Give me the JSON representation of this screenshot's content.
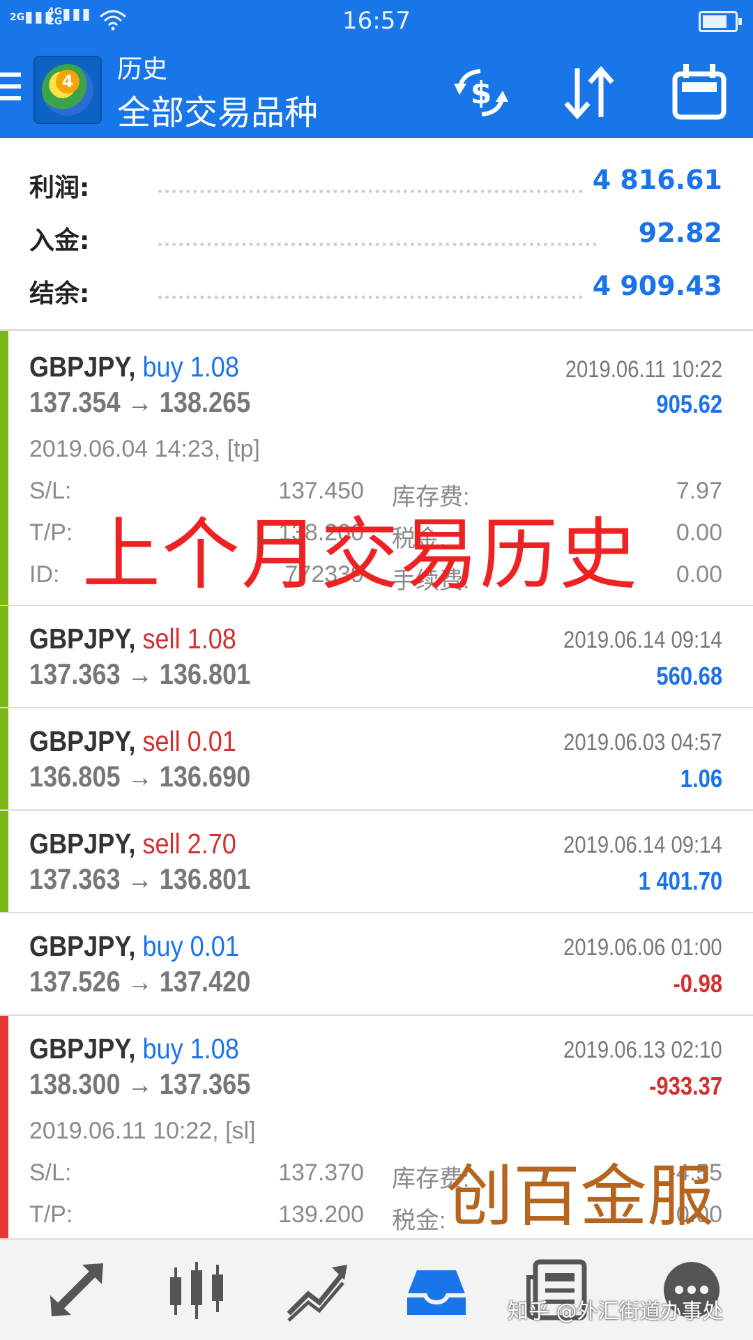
{
  "status_bar": {
    "signal_left": "2G",
    "signal_mid": "4G",
    "signal_mid2": "2G",
    "time": "16:57"
  },
  "header": {
    "title": "历史",
    "subtitle": "全部交易品种",
    "icons": [
      "menu-icon",
      "metatrader-logo",
      "currency-exchange-icon",
      "sort-icon",
      "calendar-icon"
    ]
  },
  "summary": [
    {
      "label": "利润:",
      "value": "4 816.61"
    },
    {
      "label": "入金:",
      "value": "92.82"
    },
    {
      "label": "结余:",
      "value": "4 909.43"
    }
  ],
  "colors": {
    "brand": "#1976e8",
    "positive": "#1a73e8",
    "negative": "#d32f2f",
    "bar_green": "#7cb518",
    "bar_red": "#e53935"
  },
  "trades": [
    {
      "symbol": "GBPJPY,",
      "side": "buy",
      "volume": "1.08",
      "prices": "137.354 → 138.265",
      "close_time": "2019.06.11 10:22",
      "profit": "905.62",
      "expanded": true,
      "open_info": "2019.06.04 14:23, [tp]",
      "sl_label": "S/L:",
      "sl": "137.450",
      "tp_label": "T/P:",
      "tp": "138.200",
      "id_label": "ID:",
      "id": "772339",
      "swap_label": "库存费:",
      "swap": "7.97",
      "tax_label": "税金:",
      "tax": "0.00",
      "fee_label": "手续费:",
      "fee": "0.00"
    },
    {
      "symbol": "GBPJPY,",
      "side": "sell",
      "volume": "1.08",
      "prices": "137.363 → 136.801",
      "close_time": "2019.06.14 09:14",
      "profit": "560.68"
    },
    {
      "symbol": "GBPJPY,",
      "side": "sell",
      "volume": "0.01",
      "prices": "136.805 → 136.690",
      "close_time": "2019.06.03 04:57",
      "profit": "1.06"
    },
    {
      "symbol": "GBPJPY,",
      "side": "sell",
      "volume": "2.70",
      "prices": "137.363 → 136.801",
      "close_time": "2019.06.14 09:14",
      "profit": "1 401.70"
    },
    {
      "symbol": "GBPJPY,",
      "side": "buy",
      "volume": "0.01",
      "prices": "137.526 → 137.420",
      "close_time": "2019.06.06 01:00",
      "profit": "-0.98"
    },
    {
      "symbol": "GBPJPY,",
      "side": "buy",
      "volume": "1.08",
      "prices": "138.300 → 137.365",
      "close_time": "2019.06.13 02:10",
      "profit": "-933.37",
      "expanded": true,
      "open_info": "2019.06.11 10:22, [sl]",
      "sl_label": "S/L:",
      "sl": "137.370",
      "tp_label": "T/P:",
      "tp": "139.200",
      "swap_label": "库存费:",
      "swap": "-4.55",
      "tax_label": "税金:",
      "tax": "0.00"
    }
  ],
  "overlays": {
    "title": "上个月交易历史",
    "brand": "创百金服"
  },
  "bottom_nav": [
    "trade-icon",
    "chart-icon",
    "trend-icon",
    "history-icon",
    "news-icon",
    "chat-icon"
  ],
  "watermark": "知乎 @外汇街道办事处"
}
